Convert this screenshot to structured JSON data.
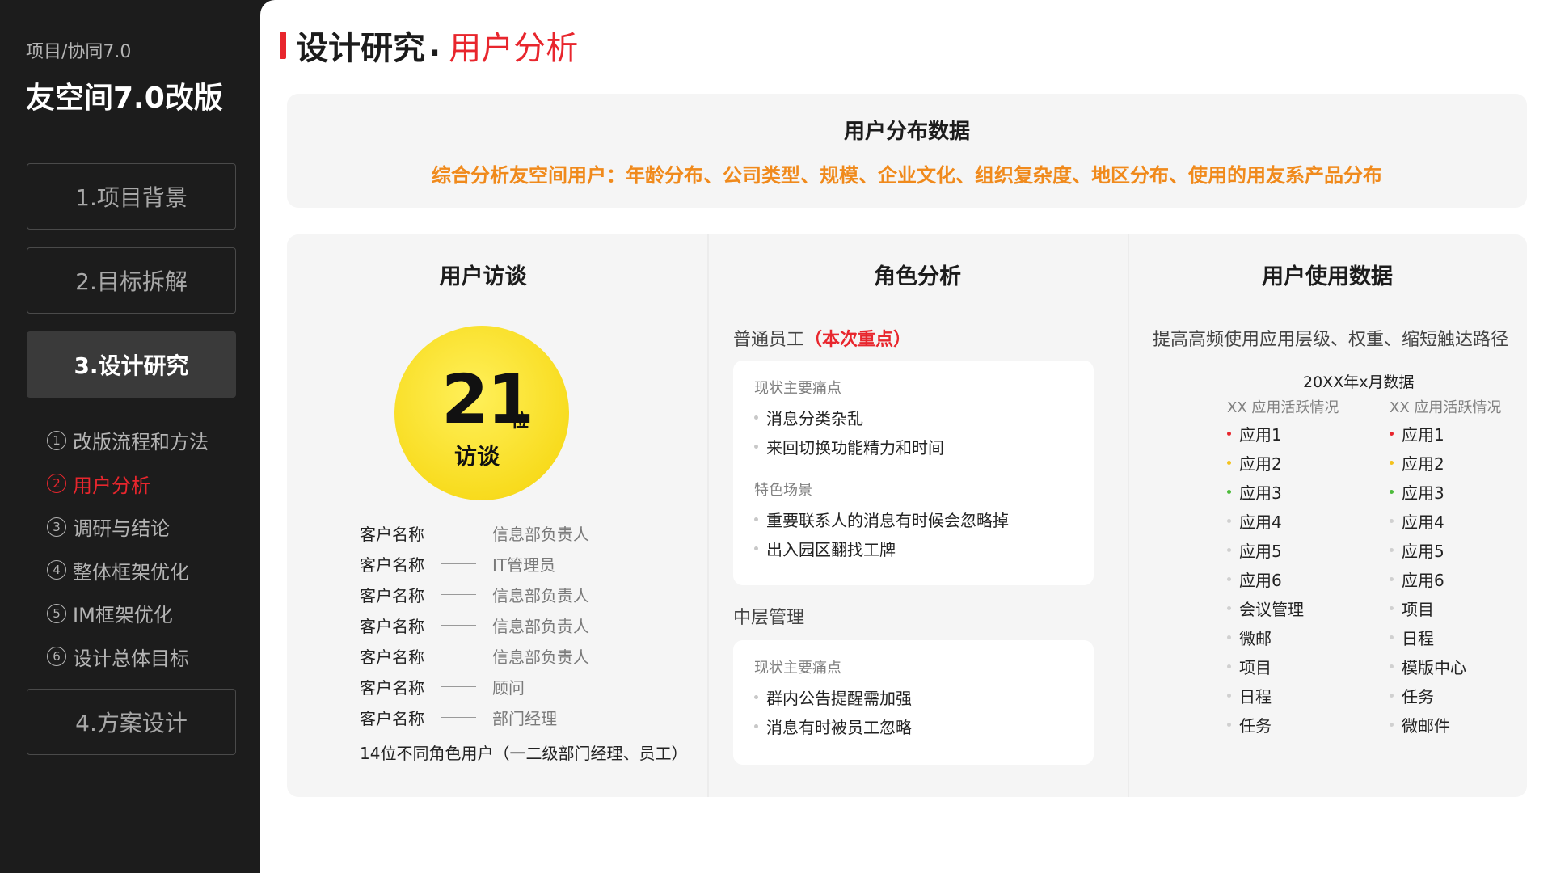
{
  "sidebar": {
    "breadcrumb": "项目/协同7.0",
    "title": "友空间7.0改版",
    "nav": [
      "1.项目背景",
      "2.目标拆解",
      "3.设计研究",
      "4.方案设计"
    ],
    "subnav": [
      {
        "num": "1",
        "label": "改版流程和方法"
      },
      {
        "num": "2",
        "label": "用户分析"
      },
      {
        "num": "3",
        "label": "调研与结论"
      },
      {
        "num": "4",
        "label": "整体框架优化"
      },
      {
        "num": "5",
        "label": "IM框架优化"
      },
      {
        "num": "6",
        "label": "设计总体目标"
      }
    ]
  },
  "header": {
    "title": "设计研究",
    "dot": ".",
    "subtitle": "用户分析"
  },
  "banner": {
    "title": "用户分布数据",
    "subtitle": "综合分析友空间用户：年龄分布、公司类型、规模、企业文化、组织复杂度、地区分布、使用的用友系产品分布"
  },
  "interviews": {
    "title": "用户访谈",
    "count": "21",
    "unit": "位",
    "label": "访谈",
    "rows": [
      {
        "name": "客户名称",
        "role": "信息部负责人"
      },
      {
        "name": "客户名称",
        "role": "IT管理员"
      },
      {
        "name": "客户名称",
        "role": "信息部负责人"
      },
      {
        "name": "客户名称",
        "role": "信息部负责人"
      },
      {
        "name": "客户名称",
        "role": "信息部负责人"
      },
      {
        "name": "客户名称",
        "role": "顾问"
      },
      {
        "name": "客户名称",
        "role": "部门经理"
      }
    ],
    "note": "14位不同角色用户（一二级部门经理、员工）"
  },
  "roles": {
    "title": "角色分析",
    "staff": {
      "label": "普通员工",
      "highlight": "（本次重点）",
      "pain_title": "现状主要痛点",
      "pains": [
        "消息分类杂乱",
        "来回切换功能精力和时间"
      ],
      "scene_title": "特色场景",
      "scenes": [
        "重要联系人的消息有时候会忽略掉",
        "出入园区翻找工牌"
      ]
    },
    "manager": {
      "label": "中层管理",
      "pain_title": "现状主要痛点",
      "pains": [
        "群内公告提醒需加强",
        "消息有时被员工忽略"
      ]
    }
  },
  "usage": {
    "title": "用户使用数据",
    "subtitle": "提高高频使用应用层级、权重、缩短触达路径",
    "date": "20XX年x月数据",
    "columns": [
      {
        "header": "XX 应用活跃情况",
        "items": [
          "应用1",
          "应用2",
          "应用3",
          "应用4",
          "应用5",
          "应用6",
          "会议管理",
          "微邮",
          "项目",
          "日程",
          "任务"
        ]
      },
      {
        "header": "XX 应用活跃情况",
        "items": [
          "应用1",
          "应用2",
          "应用3",
          "应用4",
          "应用5",
          "应用6",
          "项目",
          "日程",
          "模版中心",
          "任务",
          "微邮件"
        ]
      }
    ],
    "dot_colors": [
      "#e8262d",
      "#f4c21c",
      "#4cbb3a"
    ]
  }
}
